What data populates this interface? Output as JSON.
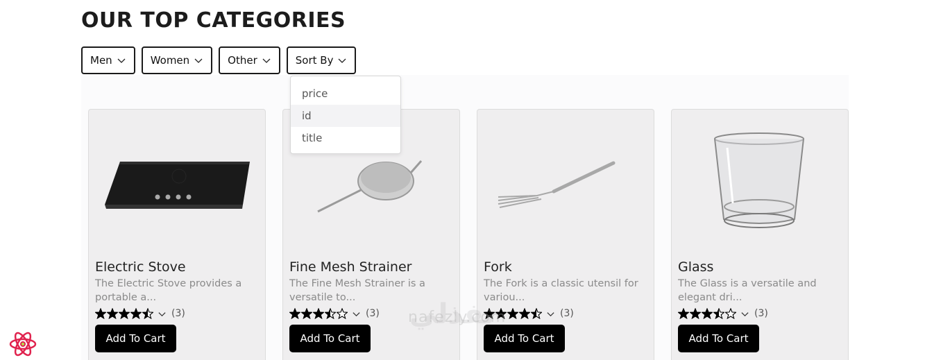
{
  "page": {
    "title": "OUR TOP CATEGORIES"
  },
  "filters": [
    {
      "label": "Men"
    },
    {
      "label": "Women"
    },
    {
      "label": "Other"
    },
    {
      "label": "Sort By"
    }
  ],
  "sort_dropdown": {
    "options": [
      "price",
      "id",
      "title"
    ],
    "highlighted": "id"
  },
  "products": [
    {
      "title": "Electric Stove",
      "description": "The Electric Stove provides a portable a...",
      "rating": 4.5,
      "review_count": "(3)",
      "cart_label": "Add To Cart",
      "image_icon": "electric-stove-image"
    },
    {
      "title": "Fine Mesh Strainer",
      "description": "The Fine Mesh Strainer is a versatile to...",
      "rating": 3.5,
      "review_count": "(3)",
      "cart_label": "Add To Cart",
      "image_icon": "strainer-image"
    },
    {
      "title": "Fork",
      "description": "The Fork is a classic utensil for variou...",
      "rating": 4.5,
      "review_count": "(3)",
      "cart_label": "Add To Cart",
      "image_icon": "fork-image"
    },
    {
      "title": "Glass",
      "description": "The Glass is a versatile and elegant dri...",
      "rating": 3.5,
      "review_count": "(3)",
      "cart_label": "Add To Cart",
      "image_icon": "glass-image"
    }
  ],
  "watermark": {
    "text": "nafezly.com",
    "arabic": "نفذلي"
  },
  "colors": {
    "button_bg": "#000000",
    "card_bg": "#efeeef",
    "react_logo": "#e0234e"
  }
}
